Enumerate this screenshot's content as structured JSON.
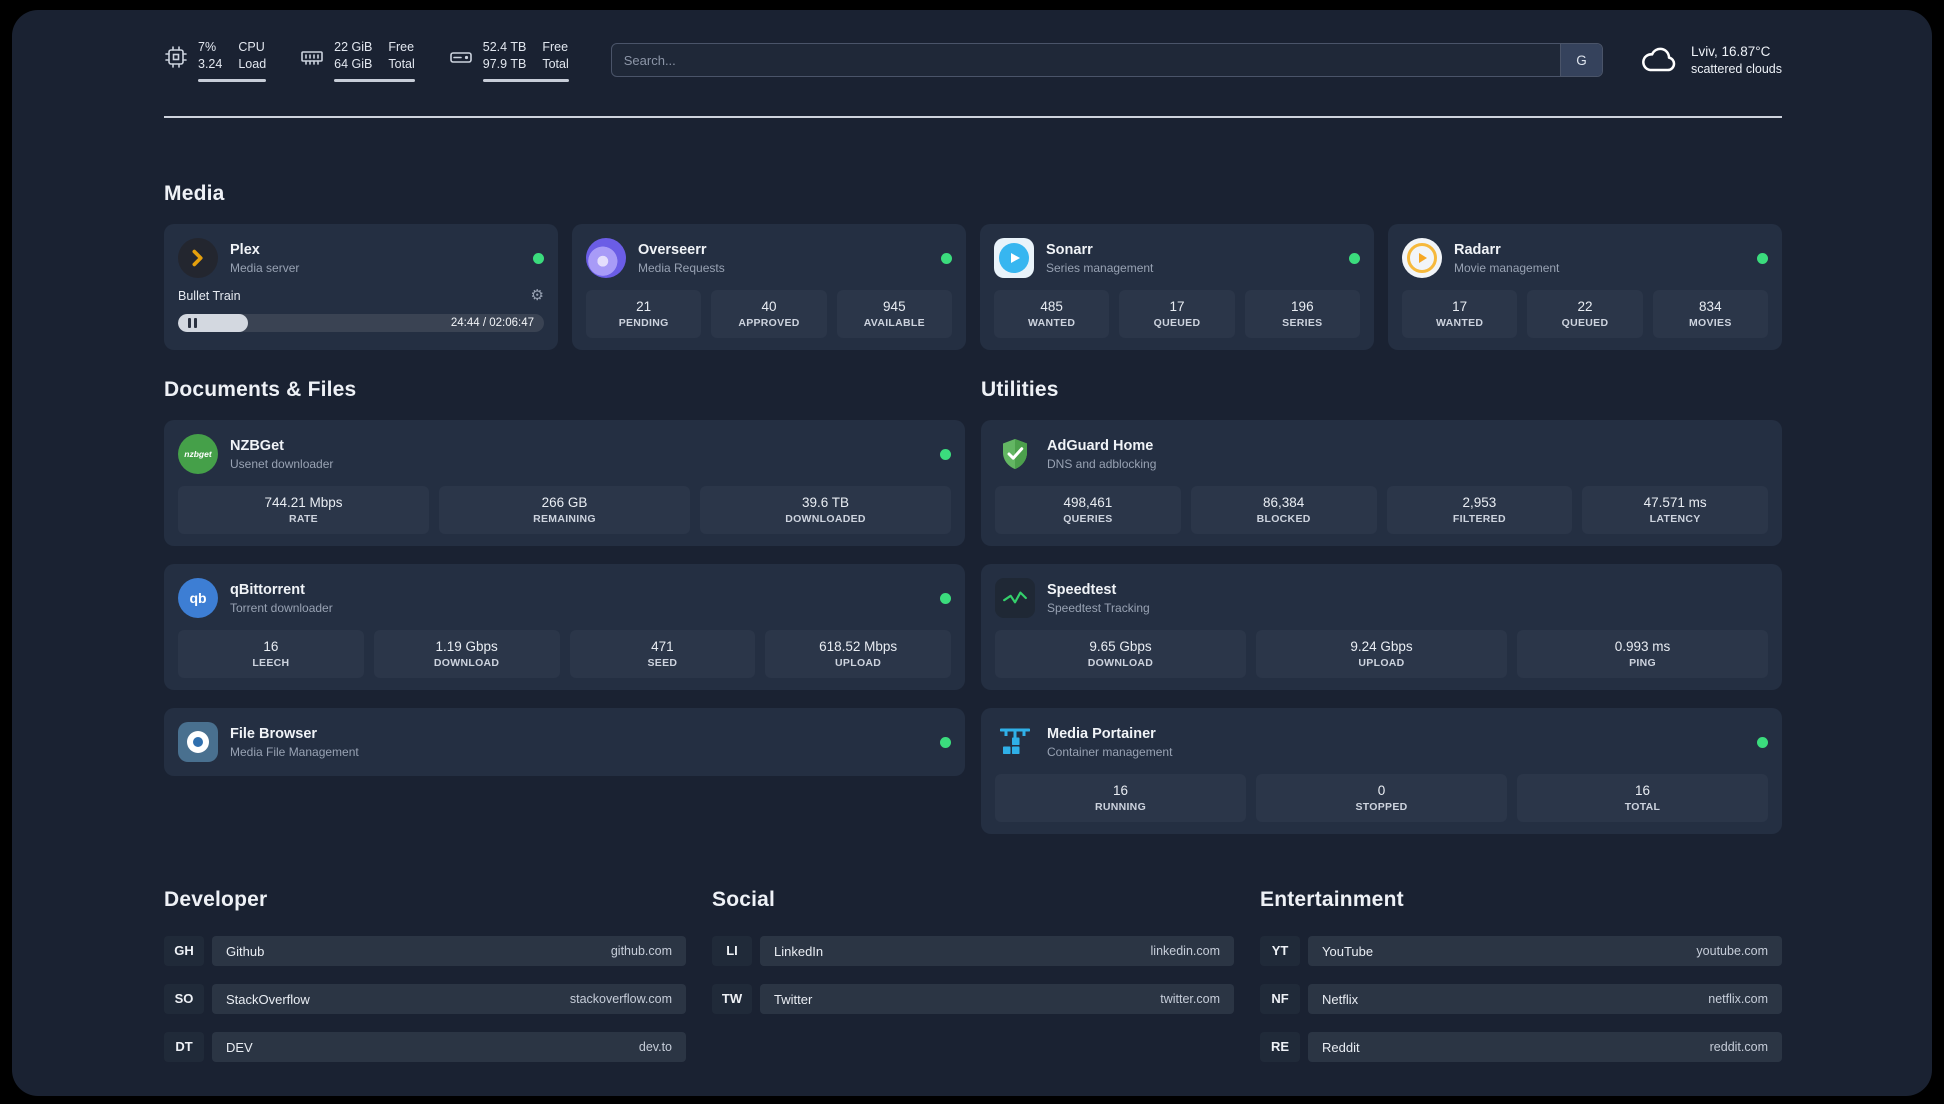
{
  "colors": {
    "panel_bg": "#1a2232",
    "card_bg": "#242f42",
    "stat_bg": "#2b3649",
    "status_ok_green": "#3bdc7d",
    "plex_amber": "#e5a00d",
    "sonarr_blue": "#37b6f0",
    "radarr_amber": "#f6b93c",
    "nzbget_green": "#45a049",
    "qbittorrent_blue": "#3d7ed4",
    "adguard_green": "#63b663",
    "portainer_blue": "#2fb0e8"
  },
  "topbar": {
    "cpu": {
      "percent": "7%",
      "load": "3.24",
      "label1": "CPU",
      "label2": "Load"
    },
    "ram": {
      "v1": "22 GiB",
      "v2": "64 GiB",
      "l1": "Free",
      "l2": "Total"
    },
    "disk": {
      "v1": "52.4 TB",
      "v2": "97.9 TB",
      "l1": "Free",
      "l2": "Total"
    },
    "search": {
      "placeholder": "Search...",
      "button": "G"
    },
    "weather": {
      "line1": "Lviv, 16.87°C",
      "line2": "scattered clouds"
    }
  },
  "media": {
    "heading": "Media",
    "plex": {
      "name": "Plex",
      "subtitle": "Media server",
      "track": "Bullet Train",
      "time": "24:44 / 02:06:47",
      "progress_percent": 19
    },
    "overseerr": {
      "name": "Overseerr",
      "subtitle": "Media Requests",
      "stats": [
        {
          "value": "21",
          "label": "PENDING"
        },
        {
          "value": "40",
          "label": "APPROVED"
        },
        {
          "value": "945",
          "label": "AVAILABLE"
        }
      ]
    },
    "sonarr": {
      "name": "Sonarr",
      "subtitle": "Series management",
      "stats": [
        {
          "value": "485",
          "label": "WANTED"
        },
        {
          "value": "17",
          "label": "QUEUED"
        },
        {
          "value": "196",
          "label": "SERIES"
        }
      ]
    },
    "radarr": {
      "name": "Radarr",
      "subtitle": "Movie management",
      "stats": [
        {
          "value": "17",
          "label": "WANTED"
        },
        {
          "value": "22",
          "label": "QUEUED"
        },
        {
          "value": "834",
          "label": "MOVIES"
        }
      ]
    }
  },
  "documents": {
    "heading": "Documents & Files",
    "nzbget": {
      "name": "NZBGet",
      "subtitle": "Usenet downloader",
      "icon_text": "nzbget",
      "stats": [
        {
          "value": "744.21 Mbps",
          "label": "RATE"
        },
        {
          "value": "266 GB",
          "label": "REMAINING"
        },
        {
          "value": "39.6 TB",
          "label": "DOWNLOADED"
        }
      ]
    },
    "qbittorrent": {
      "name": "qBittorrent",
      "subtitle": "Torrent downloader",
      "icon_text": "qb",
      "stats": [
        {
          "value": "16",
          "label": "LEECH"
        },
        {
          "value": "1.19 Gbps",
          "label": "DOWNLOAD"
        },
        {
          "value": "471",
          "label": "SEED"
        },
        {
          "value": "618.52 Mbps",
          "label": "UPLOAD"
        }
      ]
    },
    "filebrowser": {
      "name": "File Browser",
      "subtitle": "Media File Management"
    }
  },
  "utilities": {
    "heading": "Utilities",
    "adguard": {
      "name": "AdGuard Home",
      "subtitle": "DNS and adblocking",
      "stats": [
        {
          "value": "498,461",
          "label": "QUERIES"
        },
        {
          "value": "86,384",
          "label": "BLOCKED"
        },
        {
          "value": "2,953",
          "label": "FILTERED"
        },
        {
          "value": "47.571 ms",
          "label": "LATENCY"
        }
      ]
    },
    "speedtest": {
      "name": "Speedtest",
      "subtitle": "Speedtest Tracking",
      "stats": [
        {
          "value": "9.65 Gbps",
          "label": "DOWNLOAD"
        },
        {
          "value": "9.24 Gbps",
          "label": "UPLOAD"
        },
        {
          "value": "0.993 ms",
          "label": "PING"
        }
      ]
    },
    "portainer": {
      "name": "Media Portainer",
      "subtitle": "Container management",
      "stats": [
        {
          "value": "16",
          "label": "RUNNING"
        },
        {
          "value": "0",
          "label": "STOPPED"
        },
        {
          "value": "16",
          "label": "TOTAL"
        }
      ]
    }
  },
  "bookmarks": {
    "developer": {
      "heading": "Developer",
      "items": [
        {
          "abbr": "GH",
          "name": "Github",
          "url": "github.com"
        },
        {
          "abbr": "SO",
          "name": "StackOverflow",
          "url": "stackoverflow.com"
        },
        {
          "abbr": "DT",
          "name": "DEV",
          "url": "dev.to"
        }
      ]
    },
    "social": {
      "heading": "Social",
      "items": [
        {
          "abbr": "LI",
          "name": "LinkedIn",
          "url": "linkedin.com"
        },
        {
          "abbr": "TW",
          "name": "Twitter",
          "url": "twitter.com"
        }
      ]
    },
    "entertainment": {
      "heading": "Entertainment",
      "items": [
        {
          "abbr": "YT",
          "name": "YouTube",
          "url": "youtube.com"
        },
        {
          "abbr": "NF",
          "name": "Netflix",
          "url": "netflix.com"
        },
        {
          "abbr": "RE",
          "name": "Reddit",
          "url": "reddit.com"
        }
      ]
    }
  }
}
